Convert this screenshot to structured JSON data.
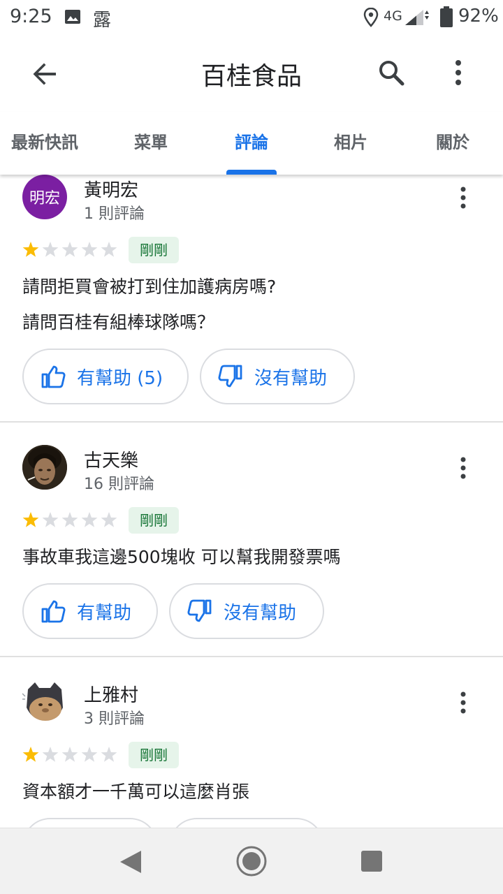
{
  "status_bar": {
    "time": "9:25",
    "label": "露",
    "network": "4G",
    "battery": "92%"
  },
  "app_bar": {
    "title": "百桂食品"
  },
  "tabs": [
    {
      "label": "最新快訊",
      "active": false
    },
    {
      "label": "菜單",
      "active": false
    },
    {
      "label": "評論",
      "active": true
    },
    {
      "label": "相片",
      "active": false
    },
    {
      "label": "關於",
      "active": false
    }
  ],
  "colors": {
    "accent": "#1a73e8",
    "star": "#fbbc04",
    "badge_bg": "#e6f4ea",
    "badge_text": "#137333",
    "avatar_purple": "#7b1fa2"
  },
  "reviews": [
    {
      "avatar_initials": "明宏",
      "name": "黃明宏",
      "review_count": "1 則評論",
      "rating": 1,
      "time": "剛剛",
      "text_lines": [
        "請問拒買會被打到住加護病房嗎?",
        "請問百桂有組棒球隊嗎？"
      ],
      "helpful_label": "有幫助 (5)",
      "not_helpful_label": "沒有幫助"
    },
    {
      "avatar_initials": "",
      "name": "古天樂",
      "review_count": "16 則評論",
      "rating": 1,
      "time": "剛剛",
      "text_lines": [
        "事故車我這邊500塊收 可以幫我開發票嗎"
      ],
      "helpful_label": "有幫助",
      "not_helpful_label": "沒有幫助"
    },
    {
      "avatar_initials": "",
      "name": "上雅村",
      "review_count": "3 則評論",
      "rating": 1,
      "time": "剛剛",
      "text_lines": [
        "資本額才一千萬可以這麼肖張"
      ],
      "helpful_label": "",
      "not_helpful_label": ""
    }
  ],
  "icons": {
    "back": "arrow-back-icon",
    "search": "search-icon",
    "more": "more-vert-icon",
    "thumb_up": "thumb-up-icon",
    "thumb_down": "thumb-down-icon"
  }
}
